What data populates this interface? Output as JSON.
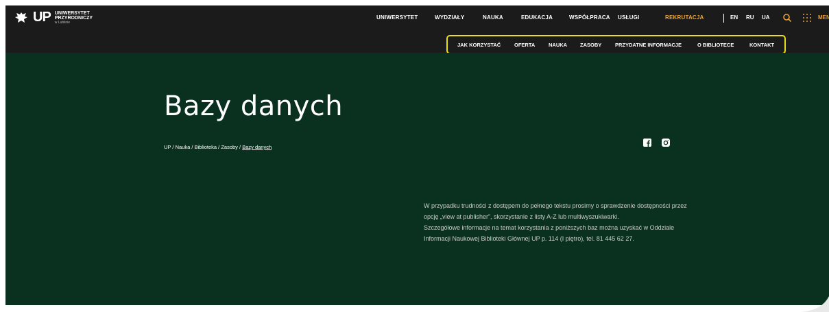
{
  "logo": {
    "brand": "UP",
    "line1": "UNIWERSYTET",
    "line2": "PRZYRODNICZY",
    "line3": "w Lublinie"
  },
  "main_nav": [
    {
      "label": "UNIWERSYTET"
    },
    {
      "label": "WYDZIAŁY"
    },
    {
      "label": "NAUKA"
    },
    {
      "label": "EDUKACJA"
    },
    {
      "label": "WSPÓŁPRACA"
    },
    {
      "label": "USŁUGI"
    },
    {
      "label": "REKRUTACJA"
    }
  ],
  "languages": [
    "EN",
    "RU",
    "UA"
  ],
  "menu_label": "MENU",
  "sub_nav": [
    {
      "label": "JAK KORZYSTAĆ"
    },
    {
      "label": "OFERTA"
    },
    {
      "label": "NAUKA"
    },
    {
      "label": "ZASOBY"
    },
    {
      "label": "PRZYDATNE INFORMACJE"
    },
    {
      "label": "O BIBLIOTECE"
    },
    {
      "label": "KONTAKT"
    }
  ],
  "page": {
    "title": "Bazy danych",
    "breadcrumb": [
      "UP",
      "Nauka",
      "Biblioteka",
      "Zasoby",
      "Bazy danych"
    ],
    "info_p1": "W przypadku trudności z dostępem do pełnego tekstu prosimy o sprawdzenie dostępności przez opcję „view at publisher”, skorzystanie z listy A-Z lub multiwyszukiwarki.",
    "info_p2": "Szczegółowe informacje na temat korzystania z poniższych baz można uzyskać w Oddziale Informacji Naukowej Biblioteki Głównej UP p. 114 (I piętro), tel. 81 445 62 27."
  },
  "colors": {
    "topbar": "#1b1b1b",
    "hero": "#0a3020",
    "accent": "#e8a33a",
    "highlight": "#e8df1c"
  }
}
